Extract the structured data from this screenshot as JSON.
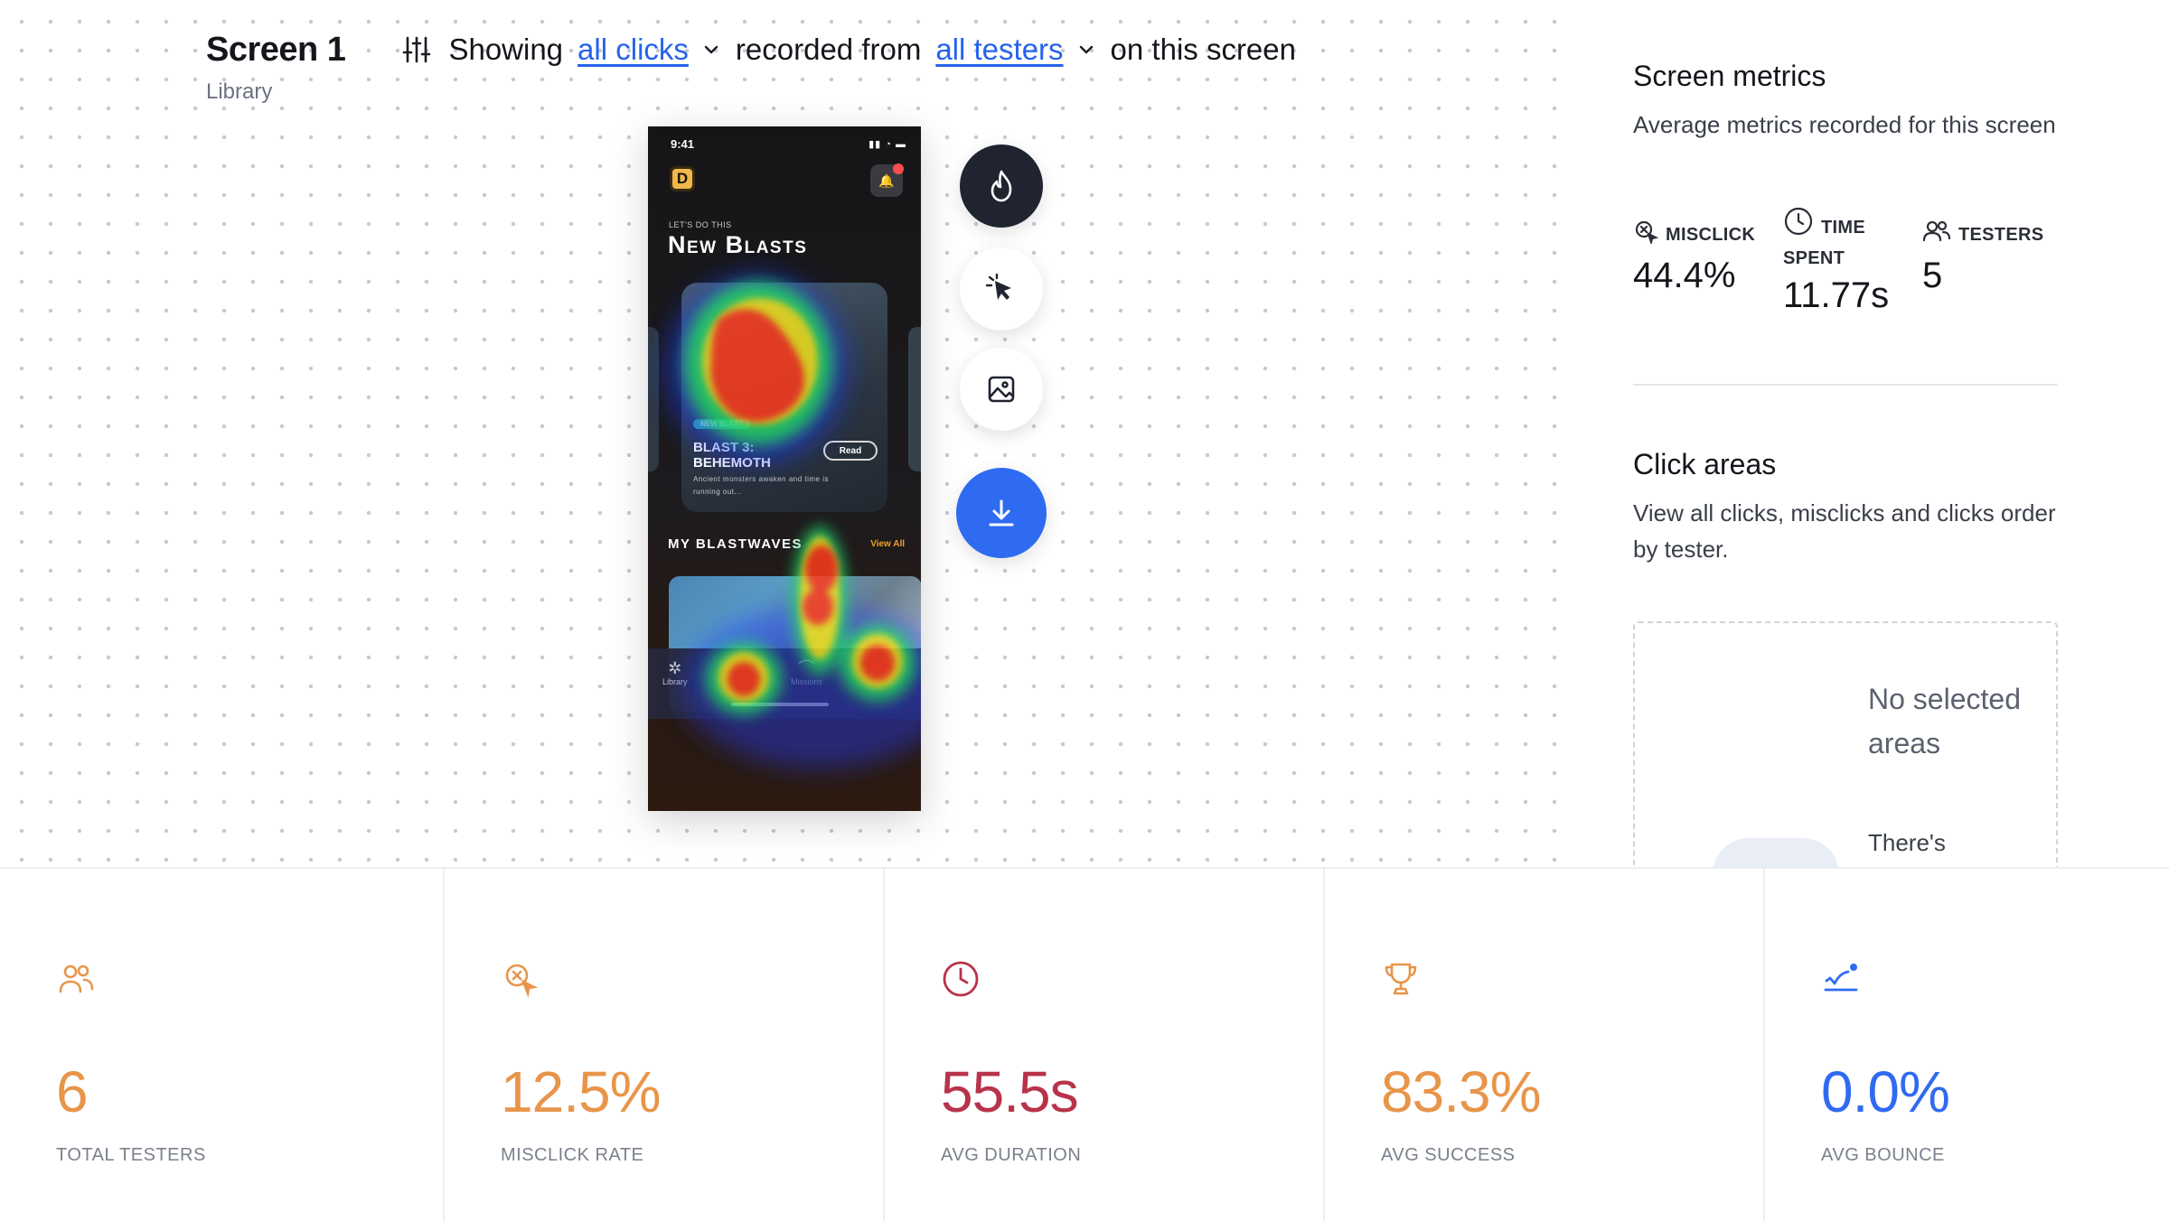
{
  "header": {
    "title": "Screen 1",
    "subtitle": "Library",
    "showing_label": "Showing",
    "clicks_filter": "all clicks",
    "recorded_from_label": "recorded from",
    "testers_filter": "all testers",
    "suffix_label": "on this screen"
  },
  "phone": {
    "status_time": "9:41",
    "logo_letter": "D",
    "kicker": "LET'S DO THIS",
    "title": "New Blasts",
    "badge": "NEW BLAST",
    "card_title": "BLAST 3: BEHEMOTH",
    "read_label": "Read",
    "card_desc": "Ancient monsters awaken and time is running out...",
    "section_title": "MY BLASTWAVES",
    "view_all": "View All",
    "tabs": [
      {
        "label": "Library"
      },
      {
        "label": "Missions"
      }
    ]
  },
  "tools": {
    "heatmap": "heatmap-flame-icon",
    "clicks": "cursor-click-icon",
    "image": "image-icon",
    "download": "download-icon"
  },
  "panel": {
    "metrics_title": "Screen metrics",
    "metrics_desc": "Average metrics recorded for this screen",
    "misclick_label": "MISCLICK",
    "misclick_value": "44.4%",
    "time_label": "TIME SPENT",
    "time_value": "11.77s",
    "testers_label": "TESTERS",
    "testers_value": "5",
    "click_areas_title": "Click areas",
    "click_areas_desc": "View all clicks, misclicks and clicks order by tester.",
    "empty_title": "No selected areas",
    "empty_text": "There's"
  },
  "stats": [
    {
      "label": "TOTAL TESTERS",
      "value": "6",
      "color": "#e8954a",
      "icon": "users-icon"
    },
    {
      "label": "MISCLICK RATE",
      "value": "12.5%",
      "color": "#e8954a",
      "icon": "misclick-icon"
    },
    {
      "label": "AVG DURATION",
      "value": "55.5s",
      "color": "#b8334a",
      "icon": "clock-icon"
    },
    {
      "label": "AVG SUCCESS",
      "value": "83.3%",
      "color": "#e8954a",
      "icon": "trophy-icon"
    },
    {
      "label": "AVG BOUNCE",
      "value": "0.0%",
      "color": "#2f6bf0",
      "icon": "bounce-icon"
    }
  ]
}
